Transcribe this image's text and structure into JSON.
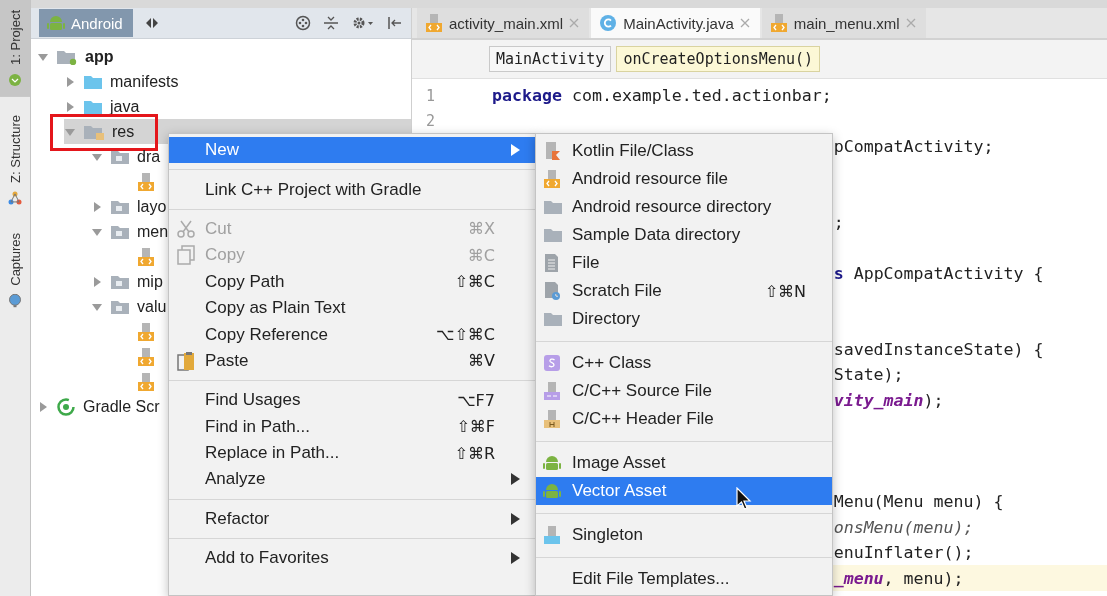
{
  "tool_window_tabs": [
    {
      "label": "1: Project",
      "selected": true
    },
    {
      "label": "Z: Structure",
      "selected": false
    },
    {
      "label": "Captures",
      "selected": false
    }
  ],
  "project_panel": {
    "view_selector": "Android",
    "tree": [
      {
        "label": "app",
        "kind": "module",
        "expanded": true,
        "selected": false,
        "children": [
          {
            "label": "manifests",
            "kind": "source_folder",
            "expanded": false,
            "selected": false
          },
          {
            "label": "java",
            "kind": "source_folder",
            "expanded": false,
            "selected": false
          },
          {
            "label": "res",
            "kind": "res_folder",
            "expanded": true,
            "selected": true,
            "highlighted": true,
            "children": [
              {
                "label": "dra",
                "kind": "folder",
                "expanded": true,
                "selected": false,
                "children": [
                  {
                    "kind": "xml_file",
                    "selected": false
                  }
                ]
              },
              {
                "label": "layo",
                "kind": "folder",
                "expanded": false,
                "selected": false
              },
              {
                "label": "men",
                "kind": "folder",
                "expanded": true,
                "selected": false,
                "children": [
                  {
                    "kind": "xml_file",
                    "selected": false
                  }
                ]
              },
              {
                "label": "mip",
                "kind": "folder",
                "expanded": false,
                "selected": false
              },
              {
                "label": "valu",
                "kind": "folder",
                "expanded": true,
                "selected": false,
                "children": [
                  {
                    "kind": "xml_file",
                    "selected": false
                  },
                  {
                    "kind": "xml_file",
                    "selected": false
                  },
                  {
                    "kind": "xml_file",
                    "selected": false
                  }
                ]
              }
            ]
          }
        ]
      },
      {
        "label": "Gradle Scr",
        "kind": "gradle",
        "expanded": false,
        "selected": false
      }
    ]
  },
  "editor": {
    "tabs": [
      {
        "label": "activity_main.xml",
        "kind": "xml",
        "selected": false
      },
      {
        "label": "MainActivity.java",
        "kind": "java",
        "selected": true
      },
      {
        "label": "main_menu.xml",
        "kind": "xml",
        "selected": false
      }
    ],
    "breadcrumbs": [
      {
        "label": "MainActivity",
        "selected": false
      },
      {
        "label": "onCreateOptionsMenu()",
        "selected": true
      }
    ],
    "lines": [
      {
        "number": "1",
        "kind": "full",
        "segments": [
          {
            "text": "package",
            "kind": "keyword"
          },
          {
            "text": " com.example.ted.actionbar;",
            "kind": "plain"
          }
        ]
      },
      {
        "number": "2",
        "kind": "full"
      },
      {
        "kind": "tail",
        "segments": [
          {
            "text": "pCompatActivity;",
            "kind": "plain"
          }
        ]
      },
      {
        "kind": "blank"
      },
      {
        "kind": "blank"
      },
      {
        "kind": "tail",
        "segments": [
          {
            "text": ";",
            "kind": "plain"
          }
        ]
      },
      {
        "kind": "blank"
      },
      {
        "kind": "tail",
        "segments": [
          {
            "text": "s",
            "kind": "keyword"
          },
          {
            "text": " AppCompatActivity {",
            "kind": "plain"
          }
        ]
      },
      {
        "kind": "blank"
      },
      {
        "kind": "blank"
      },
      {
        "kind": "tail",
        "segments": [
          {
            "text": "savedInstanceState) {",
            "kind": "plain"
          }
        ]
      },
      {
        "kind": "tail",
        "segments": [
          {
            "text": "State);",
            "kind": "plain"
          }
        ]
      },
      {
        "kind": "tail",
        "segments": [
          {
            "text": "vity_main",
            "kind": "field"
          },
          {
            "text": ");",
            "kind": "plain"
          }
        ]
      },
      {
        "kind": "blank"
      },
      {
        "kind": "blank"
      },
      {
        "kind": "blank"
      },
      {
        "kind": "tail",
        "segments": [
          {
            "text": "Menu(Menu menu) {",
            "kind": "plain"
          }
        ]
      },
      {
        "kind": "tail",
        "segments": [
          {
            "text": "onsMenu(menu);",
            "kind": "italic"
          }
        ]
      },
      {
        "kind": "tail",
        "segments": [
          {
            "text": "enuInflater();",
            "kind": "plain"
          }
        ]
      },
      {
        "kind": "tail",
        "current": true,
        "segments": [
          {
            "text": "_menu",
            "kind": "field"
          },
          {
            "text": ", menu);",
            "kind": "plain"
          }
        ]
      }
    ]
  },
  "context_menu": [
    {
      "kind": "item",
      "label": "New",
      "selected": true,
      "disabled": false,
      "submenu": true
    },
    {
      "kind": "separator"
    },
    {
      "kind": "item",
      "label": "Link C++ Project with Gradle",
      "selected": false,
      "disabled": false,
      "submenu": false
    },
    {
      "kind": "separator"
    },
    {
      "kind": "item",
      "label": "Cut",
      "shortcut": "⌘X",
      "selected": false,
      "disabled": true,
      "submenu": false
    },
    {
      "kind": "item",
      "label": "Copy",
      "shortcut": "⌘C",
      "selected": false,
      "disabled": true,
      "submenu": false
    },
    {
      "kind": "item",
      "label": "Copy Path",
      "shortcut": "⇧⌘C",
      "selected": false,
      "disabled": false,
      "submenu": false
    },
    {
      "kind": "item",
      "label": "Copy as Plain Text",
      "selected": false,
      "disabled": false,
      "submenu": false
    },
    {
      "kind": "item",
      "label": "Copy Reference",
      "shortcut": "⌥⇧⌘C",
      "selected": false,
      "disabled": false,
      "submenu": false
    },
    {
      "kind": "item",
      "label": "Paste",
      "shortcut": "⌘V",
      "selected": false,
      "disabled": false,
      "submenu": false
    },
    {
      "kind": "separator"
    },
    {
      "kind": "item",
      "label": "Find Usages",
      "shortcut": "⌥F7",
      "selected": false,
      "disabled": false,
      "submenu": false
    },
    {
      "kind": "item",
      "label": "Find in Path...",
      "shortcut": "⇧⌘F",
      "selected": false,
      "disabled": false,
      "submenu": false
    },
    {
      "kind": "item",
      "label": "Replace in Path...",
      "shortcut": "⇧⌘R",
      "selected": false,
      "disabled": false,
      "submenu": false
    },
    {
      "kind": "item",
      "label": "Analyze",
      "selected": false,
      "disabled": false,
      "submenu": true
    },
    {
      "kind": "separator"
    },
    {
      "kind": "item",
      "label": "Refactor",
      "selected": false,
      "disabled": false,
      "submenu": true
    },
    {
      "kind": "separator"
    },
    {
      "kind": "item",
      "label": "Add to Favorites",
      "selected": false,
      "disabled": false,
      "submenu": true
    }
  ],
  "new_submenu": [
    {
      "kind": "item",
      "label": "Kotlin File/Class",
      "selected": false
    },
    {
      "kind": "item",
      "label": "Android resource file",
      "selected": false
    },
    {
      "kind": "item",
      "label": "Android resource directory",
      "selected": false
    },
    {
      "kind": "item",
      "label": "Sample Data directory",
      "selected": false
    },
    {
      "kind": "item",
      "label": "File",
      "selected": false
    },
    {
      "kind": "item",
      "label": "Scratch File",
      "shortcut": "⇧⌘N",
      "selected": false
    },
    {
      "kind": "item",
      "label": "Directory",
      "selected": false
    },
    {
      "kind": "separator"
    },
    {
      "kind": "item",
      "label": "C++ Class",
      "selected": false
    },
    {
      "kind": "item",
      "label": "C/C++ Source File",
      "selected": false
    },
    {
      "kind": "item",
      "label": "C/C++ Header File",
      "selected": false
    },
    {
      "kind": "separator"
    },
    {
      "kind": "item",
      "label": "Image Asset",
      "selected": false
    },
    {
      "kind": "item",
      "label": "Vector Asset",
      "selected": true
    },
    {
      "kind": "separator"
    },
    {
      "kind": "item",
      "label": "Singleton",
      "selected": false
    },
    {
      "kind": "separator"
    },
    {
      "kind": "item",
      "label": "Edit File Templates...",
      "selected": false
    }
  ]
}
